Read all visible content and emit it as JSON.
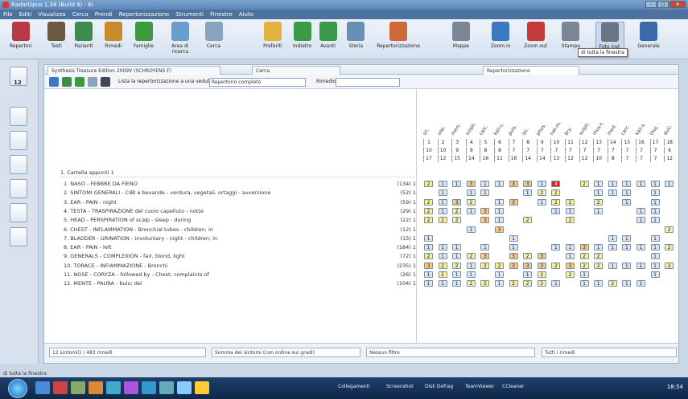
{
  "window": {
    "title": "RadarOpus 1.38 (Build 8) - EI"
  },
  "menu": [
    "File",
    "Editi",
    "Visualizza",
    "Cerca",
    "Prendi",
    "Repertorizzazione",
    "Strumenti",
    "Finestre",
    "Aiuto"
  ],
  "toolbar": {
    "items": [
      {
        "label": "Repertori",
        "color": "#b93a44"
      },
      {
        "label": "Testi",
        "color": "#6b5a40"
      },
      {
        "label": "Pazienti",
        "color": "#3c8c4c"
      },
      {
        "label": "Rimedi",
        "color": "#c98a2e"
      },
      {
        "label": "Famiglie",
        "color": "#3c9b3c"
      },
      {
        "label": "Area di ricerca",
        "color": "#6a9dcc"
      },
      {
        "label": "Cerca",
        "color": "#8aa3be"
      },
      {
        "label": "Preferiti",
        "color": "#e3b33c"
      },
      {
        "label": "Indietro",
        "color": "#3c9b4a"
      },
      {
        "label": "Avanti",
        "color": "#3c9b4a"
      },
      {
        "label": "Storia",
        "color": "#6a8fb5"
      },
      {
        "label": "Repertorizzazione",
        "color": "#cc6a3a"
      },
      {
        "label": "Mappe",
        "color": "#7a8696"
      },
      {
        "label": "Zoom in",
        "color": "#3a7ac4"
      },
      {
        "label": "Zoom out",
        "color": "#c43a3a"
      },
      {
        "label": "Stampa",
        "color": "#7a8696"
      },
      {
        "label": "Foto inst",
        "color": "#6a7686"
      },
      {
        "label": "Generale",
        "color": "#3a6aaa"
      }
    ],
    "tooltip": "di tutta la finestra"
  },
  "leftbar": {
    "badge": "12"
  },
  "tabs": {
    "book": "Synthesis Treasure Edition 2009V (SCHROYENS F)",
    "search": "Cerca",
    "rep": "Repertorizzazione"
  },
  "panelbar": {
    "list_label": "Lista la repertorizzazione a una veduta:",
    "view_select": "Repertorio completo",
    "remedy_label": "Rimedio:"
  },
  "folder": "1. Cartella appunti 1",
  "rubrics": [
    {
      "text": "1. NASO - FEBBRE DA FIENO",
      "count": "(134) 1"
    },
    {
      "text": "2. SINTOMI GENERALI - CIBI e bevande - verdura, vegetali, ortaggi - avversione",
      "count": "(52) 1"
    },
    {
      "text": "3. EAR - PAIN - night",
      "count": "(59) 1"
    },
    {
      "text": "4. TESTA - TRASPIRAZIONE del cuoio capelluto - notte",
      "count": "(29) 1"
    },
    {
      "text": "5. HEAD - PERSPIRATION of scalp - sleep - during",
      "count": "(22) 1"
    },
    {
      "text": "6. CHEST - INFLAMMATION - Bronchial tubes - children; in",
      "count": "(12) 1"
    },
    {
      "text": "7. BLADDER - URINATION - involuntary - night - children; in",
      "count": "(15) 1"
    },
    {
      "text": "8. EAR - PAIN - left",
      "count": "(184) 1"
    },
    {
      "text": "9. GENERALS - COMPLEXION - fair, blond, light",
      "count": "(72) 1"
    },
    {
      "text": "10. TORACE - INFIAMMAZIONE - Bronchi",
      "count": "(235) 1"
    },
    {
      "text": "11. NOSE - CORYZA - followed by - Chest; complaints of",
      "count": "(26) 1"
    },
    {
      "text": "12. MENTE - PAURA - buio; del",
      "count": "(104) 1"
    }
  ],
  "remedies": [
    "sil.",
    "sep.",
    "merc.",
    "sulph.",
    "calc.",
    "kali-c.",
    "puls.",
    "lyc.",
    "phos.",
    "nat-m.",
    "bry.",
    "sulph.",
    "rhus-t.",
    "med.",
    "carc.",
    "kali-s.",
    "thuj.",
    "dulc."
  ],
  "rank": [
    "1",
    "2",
    "3",
    "4",
    "5",
    "6",
    "7",
    "8",
    "9",
    "10",
    "11",
    "12",
    "13",
    "14",
    "15",
    "16",
    "17",
    "18"
  ],
  "row_scores": [
    "10",
    "10",
    "9",
    "9",
    "8",
    "8",
    "7",
    "7",
    "7",
    "7",
    "7",
    "7",
    "7",
    "7",
    "7",
    "7",
    "7",
    "6"
  ],
  "row_rubrics": [
    "17",
    "12",
    "15",
    "14",
    "16",
    "11",
    "16",
    "14",
    "14",
    "13",
    "12",
    "12",
    "10",
    "8",
    "7",
    "7",
    "7",
    "12"
  ],
  "grid": [
    [
      "2",
      "1",
      "1",
      "3",
      "1",
      "1",
      "3",
      "3",
      "1",
      "4",
      "",
      "2",
      "1",
      "1",
      "1",
      "1",
      "1",
      "1"
    ],
    [
      "",
      "1",
      "",
      "1",
      "1",
      "",
      "",
      "1",
      "2",
      "2",
      "",
      "",
      "1",
      "1",
      "1",
      "",
      "1",
      ""
    ],
    [
      "2",
      "1",
      "3",
      "2",
      "",
      "1",
      "3",
      "",
      "1",
      "2",
      "2",
      "",
      "2",
      "",
      "1",
      "",
      "1",
      ""
    ],
    [
      "2",
      "1",
      "2",
      "1",
      "3",
      "1",
      "",
      "",
      "",
      "1",
      "1",
      "",
      "1",
      "",
      "",
      "1",
      "1",
      ""
    ],
    [
      "2",
      "2",
      "2",
      "",
      "3",
      "1",
      "",
      "2",
      "",
      "",
      "2",
      "",
      "",
      "",
      "",
      "1",
      "1",
      ""
    ],
    [
      "",
      "",
      "",
      "1",
      "",
      "3",
      "",
      "",
      "",
      "",
      "",
      "",
      "",
      "",
      "",
      "",
      "",
      "2"
    ],
    [
      "1",
      "",
      "",
      "",
      "",
      "",
      "1",
      "",
      "",
      "",
      "",
      "",
      "",
      "1",
      "1",
      "",
      "1",
      ""
    ],
    [
      "1",
      "1",
      "1",
      "",
      "1",
      "",
      "1",
      "",
      "",
      "1",
      "1",
      "3",
      "1",
      "1",
      "1",
      "1",
      "1",
      "2"
    ],
    [
      "2",
      "1",
      "1",
      "2",
      "3",
      "",
      "3",
      "2",
      "3",
      "",
      "1",
      "2",
      "2",
      "",
      "",
      "",
      "1",
      ""
    ],
    [
      "3",
      "2",
      "2",
      "1",
      "2",
      "2",
      "3",
      "3",
      "3",
      "2",
      "3",
      "2",
      "2",
      "1",
      "1",
      "1",
      "1",
      "2"
    ],
    [
      "1",
      "2",
      "1",
      "1",
      "",
      "1",
      "",
      "1",
      "2",
      "",
      "2",
      "1",
      "",
      "",
      "",
      "",
      "1",
      ""
    ],
    [
      "1",
      "1",
      "1",
      "2",
      "2",
      "1",
      "2",
      "2",
      "2",
      "1",
      "",
      "1",
      "1",
      "2",
      "1",
      "1",
      "",
      ""
    ]
  ],
  "status": {
    "count": "12 sintomi() / 483 rimedi",
    "sum": "Somma dei sintomi (con ordine sui gradi)",
    "filter": "Nessun filtro",
    "remedies": "Tutti i rimedi"
  },
  "bottom_label": "di tutta la finestra",
  "taskbar": {
    "items": [
      "Collegamenti",
      "Screenshot",
      "Disk Defrag",
      "TeamViewer",
      "CCleaner"
    ],
    "clock": "18:54"
  },
  "colors": {
    "g1": "#dbe7f6",
    "g2": "#f5f1a0",
    "g3": "#f6c98a",
    "g4": "#d62a1e"
  }
}
